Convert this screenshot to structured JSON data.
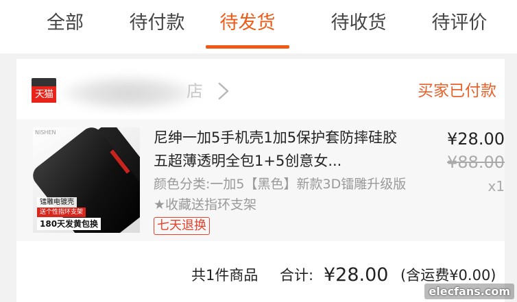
{
  "tabs": [
    {
      "label": "全部",
      "active": false
    },
    {
      "label": "待付款",
      "active": false
    },
    {
      "label": "待发货",
      "active": true
    },
    {
      "label": "待收货",
      "active": false
    },
    {
      "label": "待评价",
      "active": false
    }
  ],
  "colors": {
    "accent": "#f05a16",
    "status": "#e8622a",
    "tag": "#e8402a",
    "background": "#f2f2f2"
  },
  "order": {
    "shop": {
      "badge_label": "天猫",
      "name_tail": "店",
      "chevron_icon": "chevron-right-icon"
    },
    "status": "买家已付款",
    "product": {
      "thumbnail": {
        "brand": "NISHEN",
        "promo_line1": "镭雕电镀壳",
        "promo_line2": "送个性指环支架",
        "promo_line3": "180天发黄包换"
      },
      "title": "尼绅一加5手机壳1加5保护套防摔硅胶五超薄透明全包1+5创意女...",
      "sku": "颜色分类:一加5【黑色】新款3D镭雕升级版★收藏送指环支架",
      "return_tag": "七天退换",
      "price_current": "¥28.00",
      "price_original": "¥88.00",
      "quantity": "x1"
    },
    "summary": {
      "count_text": "共1件商品",
      "total_label": "合计:",
      "total_amount": "¥28.00",
      "shipping_text": "(含运费¥0.00)"
    }
  },
  "watermark": "elecfans.com"
}
